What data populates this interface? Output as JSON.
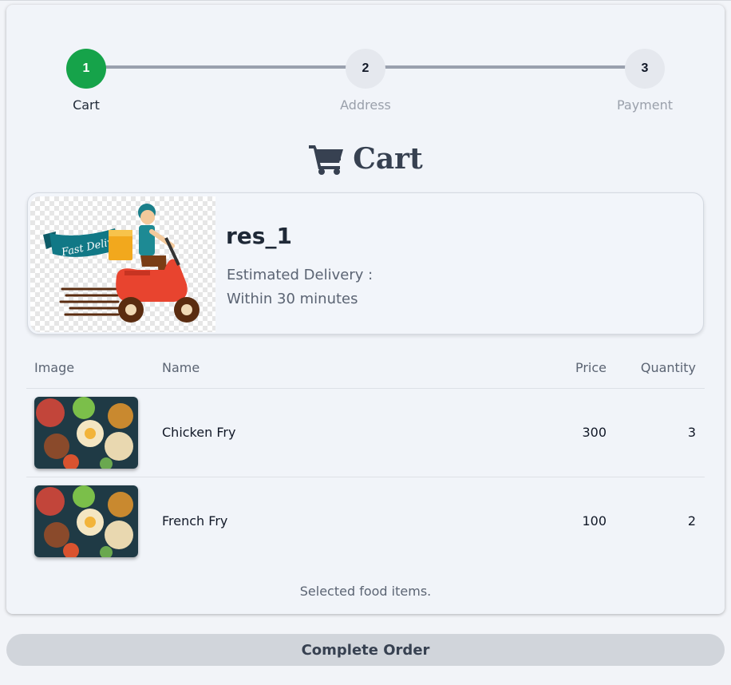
{
  "stepper": {
    "steps": [
      {
        "number": "1",
        "label": "Cart",
        "state": "active"
      },
      {
        "number": "2",
        "label": "Address",
        "state": "inactive"
      },
      {
        "number": "3",
        "label": "Payment",
        "state": "inactive"
      }
    ],
    "colors": {
      "active": "#16a34a",
      "inactive": "#e5e8ee",
      "line": "#9aa1ae"
    }
  },
  "heading": {
    "icon": "shopping-cart-icon",
    "title": "Cart"
  },
  "restaurant": {
    "name": "res_1",
    "delivery_label": "Estimated Delivery :",
    "delivery_time": "Within 30 minutes",
    "banner_text": "Fast Delivery"
  },
  "table": {
    "headers": {
      "image": "Image",
      "name": "Name",
      "price": "Price",
      "quantity": "Quantity"
    },
    "rows": [
      {
        "name": "Chicken Fry",
        "price": "300",
        "quantity": "3"
      },
      {
        "name": "French Fry",
        "price": "100",
        "quantity": "2"
      }
    ],
    "caption": "Selected food items."
  },
  "actions": {
    "complete_order": "Complete Order"
  }
}
